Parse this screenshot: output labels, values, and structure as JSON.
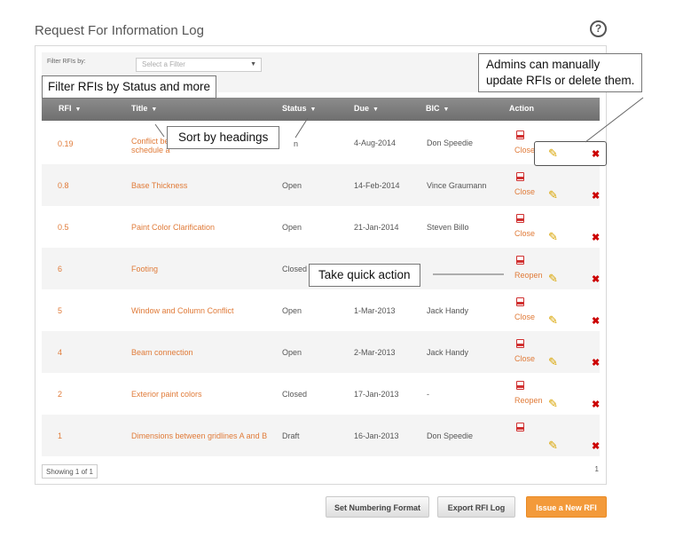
{
  "page": {
    "title": "Request For Information Log"
  },
  "filter": {
    "label": "Filter RFIs by:",
    "placeholder": "Select a Filter"
  },
  "columns": [
    "RFI",
    "Title",
    "Status",
    "Due",
    "BIC",
    "Action"
  ],
  "rows": [
    {
      "rfi": "0.19",
      "title_line1": "Conflict bet",
      "title_line2": "schedule a",
      "status": "n",
      "due": "4-Aug-2014",
      "bic": "Don Speedie",
      "action": "Close"
    },
    {
      "rfi": "0.8",
      "title": "Base Thickness",
      "status": "Open",
      "due": "14-Feb-2014",
      "bic": "Vince Graumann",
      "action": "Close"
    },
    {
      "rfi": "0.5",
      "title": "Paint Color Clarification",
      "status": "Open",
      "due": "21-Jan-2014",
      "bic": "Steven Billo",
      "action": "Close"
    },
    {
      "rfi": "6",
      "title": "Footing",
      "status": "Closed",
      "due": "",
      "bic": "",
      "action": "Reopen"
    },
    {
      "rfi": "5",
      "title": "Window and Column Conflict",
      "status": "Open",
      "due": "1-Mar-2013",
      "bic": "Jack Handy",
      "action": "Close"
    },
    {
      "rfi": "4",
      "title": "Beam connection",
      "status": "Open",
      "due": "2-Mar-2013",
      "bic": "Jack Handy",
      "action": "Close"
    },
    {
      "rfi": "2",
      "title": "Exterior paint colors",
      "status": "Closed",
      "due": "17-Jan-2013",
      "bic": "-",
      "action": "Reopen"
    },
    {
      "rfi": "1",
      "title": "Dimensions between gridlines A and B",
      "status": "Draft",
      "due": "16-Jan-2013",
      "bic": "Don Speedie",
      "action": ""
    }
  ],
  "pagination": {
    "showing": "Showing 1 of 1",
    "page": "1"
  },
  "buttons": {
    "numbering": "Set Numbering Format",
    "export": "Export RFI Log",
    "issue": "Issue a New RFI"
  },
  "callouts": {
    "filter": "Filter RFIs by Status and more",
    "sort": "Sort by headings",
    "admin_line1": "Admins can manually",
    "admin_line2": "update RFIs or delete them.",
    "quick": "Take quick action"
  },
  "colors": {
    "accent": "#e07b39",
    "button_orange": "#f39a3a",
    "delete": "#cc0000",
    "edit": "#d9a400"
  },
  "icons": {
    "help": "help-icon",
    "sort": "sort-arrow-icon",
    "pdf": "pdf-icon",
    "edit": "pencil-icon",
    "delete": "delete-x-icon"
  }
}
